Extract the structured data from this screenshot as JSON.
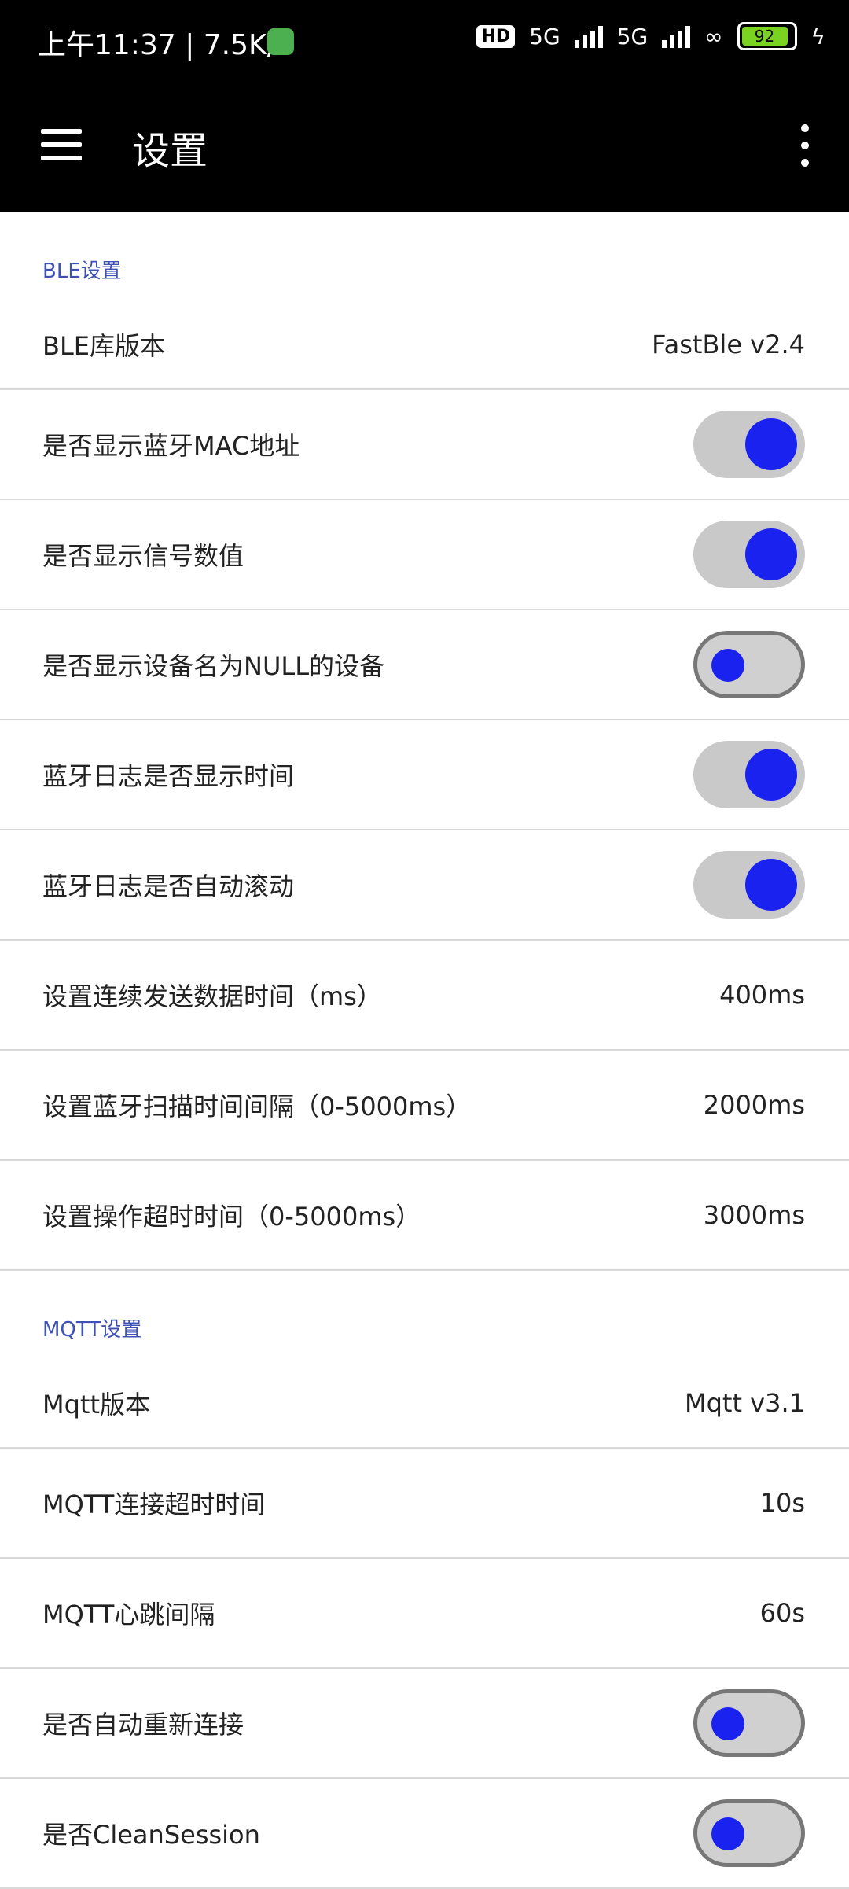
{
  "status_bar": {
    "time": "上午11:37 | 7.5K/s",
    "hd_label": "HD",
    "net1": "5G",
    "net2": "5G",
    "battery_level": "92"
  },
  "app_bar": {
    "title": "设置"
  },
  "ble_section": {
    "header": "BLE设置",
    "lib_version_label": "BLE库版本",
    "lib_version_value": "FastBle v2.4",
    "show_mac_label": "是否显示蓝牙MAC地址",
    "show_mac_on": true,
    "show_rssi_label": "是否显示信号数值",
    "show_rssi_on": true,
    "show_null_label": "是否显示设备名为NULL的设备",
    "show_null_on": false,
    "log_time_label": "蓝牙日志是否显示时间",
    "log_time_on": true,
    "log_scroll_label": "蓝牙日志是否自动滚动",
    "log_scroll_on": true,
    "send_interval_label": "设置连续发送数据时间（ms）",
    "send_interval_value": "400ms",
    "scan_interval_label": "设置蓝牙扫描时间间隔（0-5000ms）",
    "scan_interval_value": "2000ms",
    "op_timeout_label": "设置操作超时时间（0-5000ms）",
    "op_timeout_value": "3000ms"
  },
  "mqtt_section": {
    "header": "MQTT设置",
    "version_label": "Mqtt版本",
    "version_value": "Mqtt v3.1",
    "conn_timeout_label": "MQTT连接超时时间",
    "conn_timeout_value": "10s",
    "heartbeat_label": "MQTT心跳间隔",
    "heartbeat_value": "60s",
    "auto_reconnect_label": "是否自动重新连接",
    "auto_reconnect_on": false,
    "clean_session_label": "是否CleanSession",
    "clean_session_on": false
  },
  "colors": {
    "accent": "#3f51b5",
    "toggle_knob": "#1a22f0",
    "toggle_track": "#c9c9c9"
  }
}
